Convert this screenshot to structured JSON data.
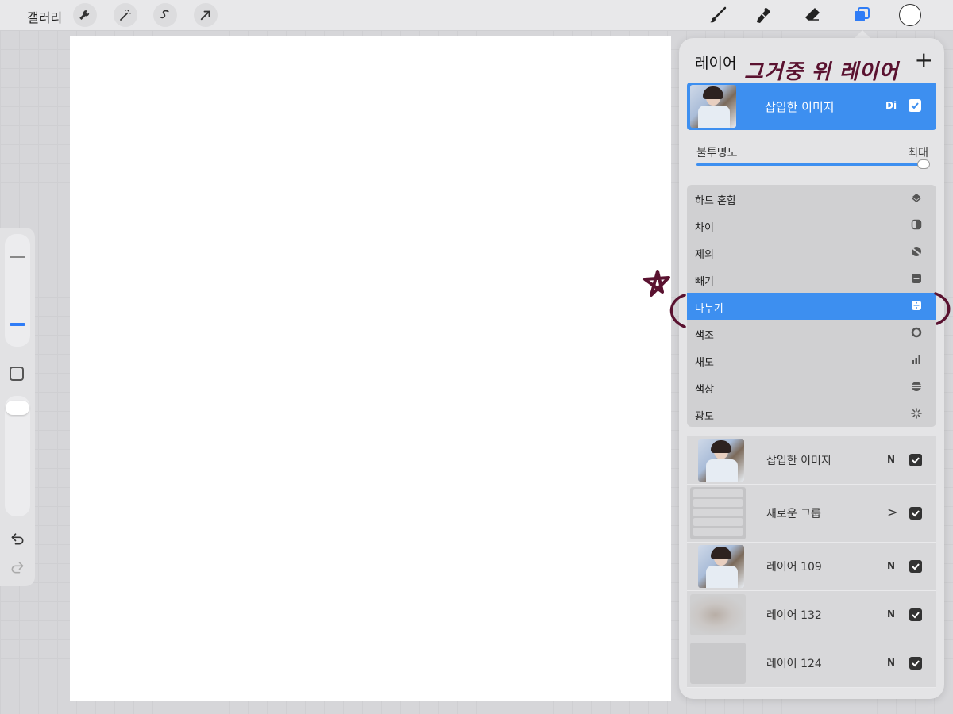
{
  "topbar": {
    "gallery_label": "갤러리",
    "left_tools": [
      "wrench-icon",
      "magic-wand-icon",
      "selection-icon",
      "transform-arrow-icon"
    ],
    "right_tools": [
      "brush-icon",
      "smudge-icon",
      "eraser-icon",
      "layers-icon"
    ],
    "color": "#ffffff",
    "accent": "#2f7cf6"
  },
  "layers_panel": {
    "title": "레이어",
    "add_symbol": "+",
    "annotation_text": "그거중 위 레이어",
    "active_layer": {
      "name": "삽입한 이미지",
      "blend_mode": "Di",
      "visible": true
    },
    "opacity": {
      "label": "불투명도",
      "value": "최대",
      "level": 1.0
    },
    "blend_modes": [
      {
        "label": "하드 혼합",
        "icon": "hard-mix-icon",
        "selected": false
      },
      {
        "label": "차이",
        "icon": "difference-icon",
        "selected": false
      },
      {
        "label": "제외",
        "icon": "exclusion-icon",
        "selected": false
      },
      {
        "label": "빼기",
        "icon": "subtract-icon",
        "selected": false
      },
      {
        "label": "나누기",
        "icon": "divide-icon",
        "selected": true
      },
      {
        "label": "색조",
        "icon": "hue-icon",
        "selected": false
      },
      {
        "label": "채도",
        "icon": "saturation-icon",
        "selected": false
      },
      {
        "label": "색상",
        "icon": "color-icon",
        "selected": false
      },
      {
        "label": "광도",
        "icon": "luminosity-icon",
        "selected": false
      }
    ],
    "layers": [
      {
        "name": "삽입한 이미지",
        "mode": "N",
        "visible": true,
        "type": "photo"
      },
      {
        "name": "새로운 그룹",
        "mode": ">",
        "visible": true,
        "type": "group"
      },
      {
        "name": "레이어 109",
        "mode": "N",
        "visible": true,
        "type": "photo"
      },
      {
        "name": "레이어 132",
        "mode": "N",
        "visible": true,
        "type": "blur"
      },
      {
        "name": "레이어 124",
        "mode": "N",
        "visible": true,
        "type": "plain"
      }
    ]
  }
}
